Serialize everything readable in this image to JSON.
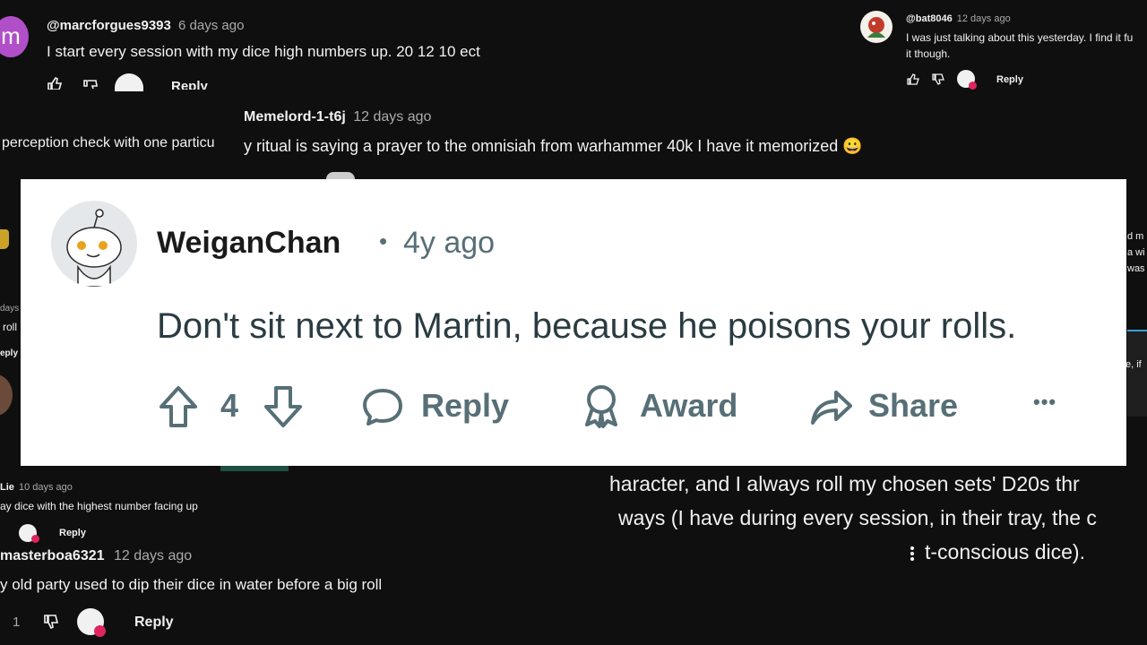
{
  "comments": {
    "c1": {
      "avatar_letter": "m",
      "user": "@marcforgues9393",
      "time": "6 days ago",
      "text": "I start every session with my dice high numbers up. 20 12 10 ect",
      "reply": "Reply"
    },
    "c2": {
      "user": "@bat8046",
      "time": "12 days ago",
      "line1": "I was just talking about this yesterday. I find it fu",
      "line2": "it though.",
      "reply": "Reply"
    },
    "c3": {
      "user": "Memelord-1-t6j",
      "time": "12 days ago",
      "text": "y ritual is saying a prayer to the omnisiah from warhammer 40k I have it memorized"
    },
    "c4": {
      "text": "perception check with one particu"
    },
    "c5": {
      "user": "Lie",
      "time": "10 days ago",
      "text": "ay dice with the highest number facing up",
      "reply": "Reply"
    },
    "c6": {
      "user": "masterboa6321",
      "time": "12 days ago",
      "text": "y old party used to dip their dice in water before a big roll",
      "likes": "1",
      "reply": "Reply"
    },
    "c7": {
      "line1": "haracter, and I always roll my chosen sets' D20s thr",
      "line2": "ways (I have during every session, in their tray, the c",
      "line3": "t-conscious dice)."
    },
    "left_frag": {
      "days": "days",
      "roll": "roll",
      "reply": "eply"
    },
    "right_frag": {
      "l1": "d m",
      "l2": "a wi",
      "l3": "was",
      "l4": "e, if"
    }
  },
  "reddit": {
    "username": "WeiganChan",
    "separator": "•",
    "age": "4y ago",
    "body": "Don't sit next to Martin, because he poisons your rolls.",
    "votes": "4",
    "reply_label": "Reply",
    "award_label": "Award",
    "share_label": "Share",
    "more_label": "•••"
  },
  "colors": {
    "background": "#0f0f0f",
    "avatar_purple": "#b14fc9",
    "card": "#ffffff",
    "reddit_gray": "#576f76"
  },
  "emoji": {
    "smile": "😀"
  }
}
